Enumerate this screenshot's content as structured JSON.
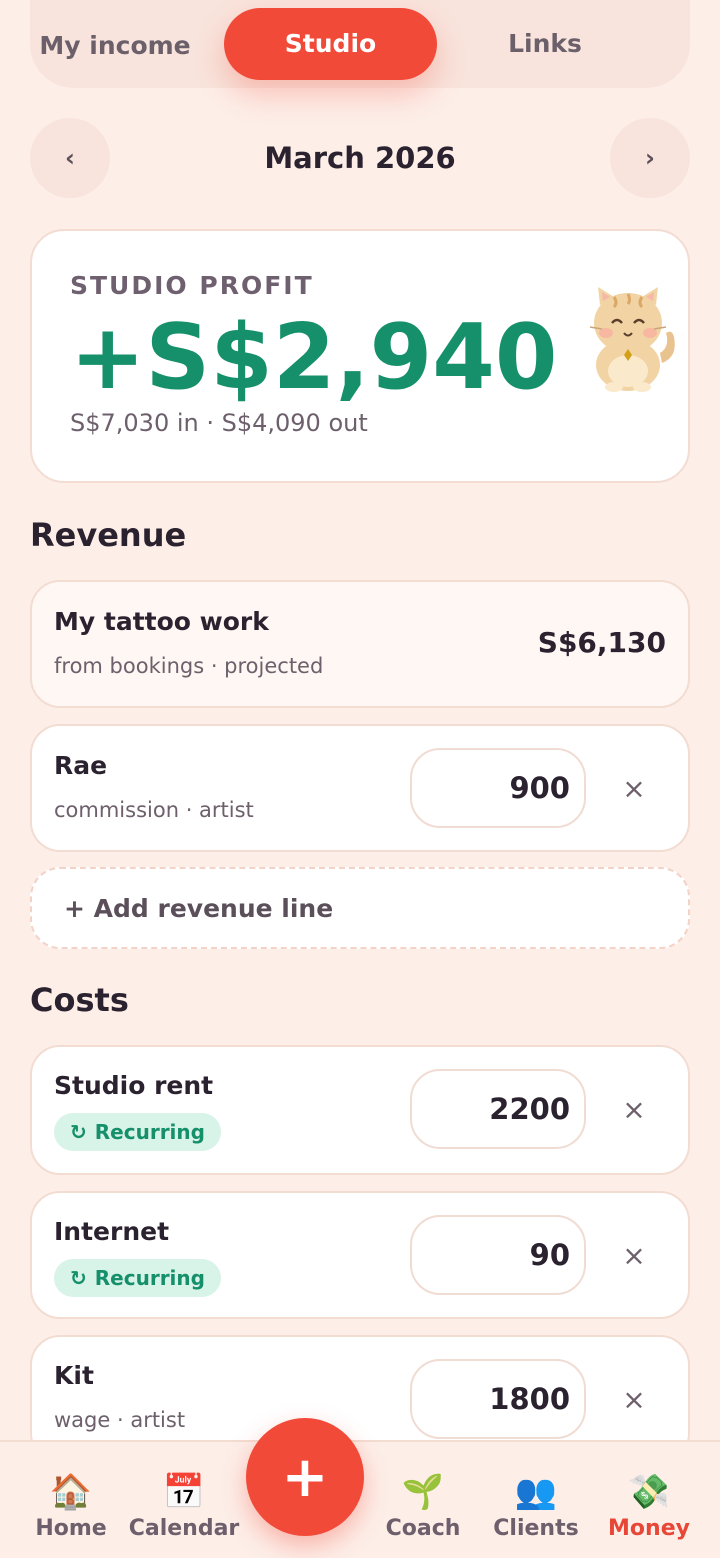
{
  "tabs": [
    {
      "label": "My income"
    },
    {
      "label": "Studio",
      "active": true
    },
    {
      "label": "Links"
    }
  ],
  "month": {
    "title": "March 2026",
    "prev_icon": "chevron-left-icon",
    "next_icon": "chevron-right-icon",
    "prev_glyph": "‹",
    "next_glyph": "›"
  },
  "profit": {
    "label": "STUDIO PROFIT",
    "value": "+S$2,940",
    "subtitle": "S$7,030 in · S$4,090 out",
    "value_color": "#15906a"
  },
  "revenue": {
    "title": "Revenue",
    "lines": [
      {
        "name": "My tattoo work",
        "sub": "from bookings · projected",
        "amount": "S$6,130"
      },
      {
        "name": "Rae",
        "sub": "commission · artist",
        "amount": "900"
      }
    ],
    "add_label": "+ Add revenue line"
  },
  "costs": {
    "title": "Costs",
    "badge_label": "Recurring",
    "badge_glyph": "↻",
    "lines": [
      {
        "name": "Studio rent",
        "amount": "2200"
      },
      {
        "name": "Internet",
        "amount": "90"
      },
      {
        "name": "Kit",
        "sub": "wage · artist",
        "amount": "1800"
      }
    ]
  },
  "remove_glyph": "×",
  "nav": {
    "items": [
      {
        "label": "Home",
        "icon": "house-icon",
        "glyph": "🏠"
      },
      {
        "label": "Calendar",
        "icon": "calendar-icon",
        "glyph": "📅"
      },
      {
        "label": "Coach",
        "icon": "seedling-icon",
        "glyph": "🌱"
      },
      {
        "label": "Clients",
        "icon": "people-icon",
        "glyph": "👥"
      },
      {
        "label": "Money",
        "icon": "money-icon",
        "glyph": "💸",
        "active": true
      }
    ],
    "fab_glyph": "+"
  },
  "colors": {
    "accent": "#f24a38",
    "background": "#fdeee8",
    "profit_green": "#15906a",
    "recurring_badge_bg": "#d8f3e8"
  }
}
